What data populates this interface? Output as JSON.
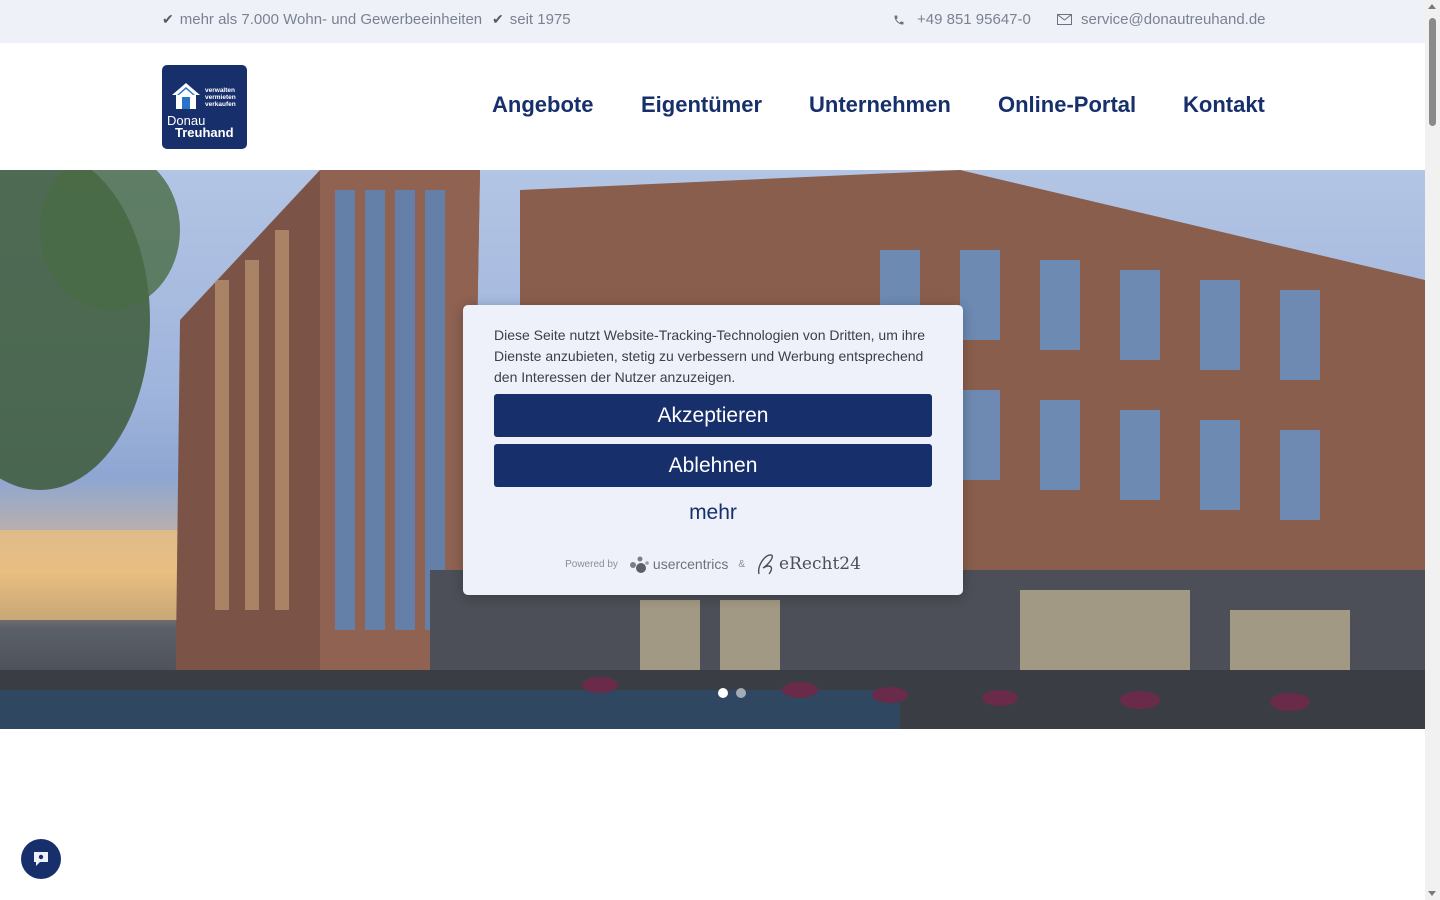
{
  "topbar": {
    "units": "mehr als 7.000 Wohn- und Gewerbeeinheiten",
    "since": "seit 1975",
    "phone": "+49 851 95647-0",
    "email": "service@donautreuhand.de"
  },
  "logo": {
    "tagline": [
      "verwalten",
      "vermieten",
      "verkaufen"
    ],
    "brand_line1": "Donau",
    "brand_line2": "Treuhand"
  },
  "nav": {
    "items": [
      "Angebote",
      "Eigentümer",
      "Unternehmen",
      "Online-Portal",
      "Kontakt"
    ]
  },
  "consent": {
    "message": "Diese Seite nutzt Website-Tracking-Technologien von Dritten, um ihre Dienste anzubieten, stetig zu verbessern und Werbung entsprechend den Interessen der Nutzer anzuzeigen.",
    "accept_label": "Akzeptieren",
    "deny_label": "Ablehnen",
    "more_label": "mehr",
    "powered_by": "Powered by",
    "provider1": "usercentrics",
    "amp": "&",
    "provider2": "eRecht24"
  },
  "slider": {
    "slide_count": 2,
    "active_index": 0
  },
  "colors": {
    "brand": "#17306b",
    "topbar_bg": "#eef2f8",
    "dialog_bg": "#eef1f9"
  },
  "icons": {
    "check": "check-icon",
    "phone": "phone-icon",
    "mail": "mail-icon",
    "chat": "chat-icon"
  }
}
